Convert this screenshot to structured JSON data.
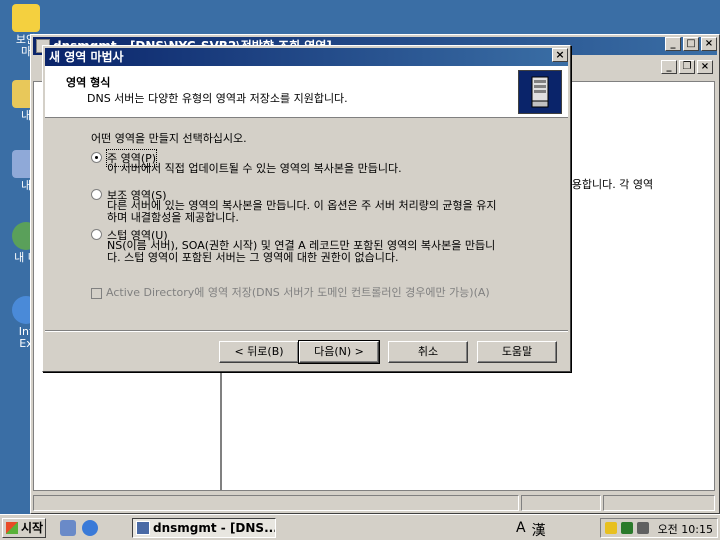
{
  "desktop": {
    "icons": [
      {
        "label": "보안",
        "label2": "마"
      },
      {
        "label": "내",
        "label2": ""
      },
      {
        "label": "내 ",
        "label2": ""
      },
      {
        "label": "내 네",
        "label2": ""
      },
      {
        "label": "Int",
        "label2": "Ex"
      }
    ]
  },
  "mmc": {
    "title": "dnsmgmt - [DNS\\NYC-SVR2\\정방향 조회 영역]",
    "right_text": "록 허용합니다. 각 영역"
  },
  "wizard": {
    "title": "새 영역 마법사",
    "close_glyph": "×",
    "header_title": "영역 형식",
    "header_subtitle": "DNS 서버는 다양한 유형의 영역과 저장소를 지원합니다.",
    "question": "어떤 영역을 만들지 선택하십시오.",
    "options": [
      {
        "label": "주 영역(P)",
        "desc1": "이 서버에서 직접 업데이트될 수 있는 영역의 복사본을 만듭니다.",
        "desc2": "",
        "checked": true
      },
      {
        "label": "보조 영역(S)",
        "desc1": "다른 서버에 있는 영역의 복사본을 만듭니다. 이 옵션은 주 서버 처리량의 균형을 유지",
        "desc2": "하며 내결함성을 제공합니다.",
        "checked": false
      },
      {
        "label": "스텁 영역(U)",
        "desc1": "NS(이름 서버), SOA(권한 시작) 및 연결 A 레코드만 포함된 영역의 복사본을 만듭니",
        "desc2": "다. 스텁 영역이 포함된 서버는 그 영역에 대한 권한이 없습니다.",
        "checked": false
      }
    ],
    "ad_checkbox": "Active Directory에 영역 저장(DNS 서버가 도메인 컨트롤러인 경우에만 가능)(A)",
    "buttons": {
      "back": "< 뒤로(B)",
      "next": "다음(N) >",
      "cancel": "취소",
      "help": "도움말"
    }
  },
  "taskbar": {
    "start": "시작",
    "task_label": "dnsmgmt - [DNS...",
    "ime_a": "A",
    "ime_han": "漢",
    "clock": "오전 10:15"
  },
  "colors": {
    "desktop": "#3a6ea5",
    "titlebar": "#0a246a",
    "face": "#d4d0c8"
  }
}
